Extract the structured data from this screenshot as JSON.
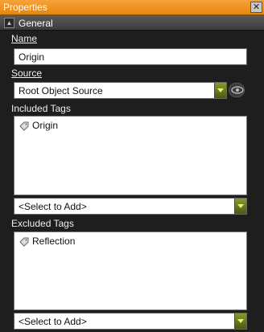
{
  "window": {
    "title": "Properties",
    "close_glyph": "✕"
  },
  "section": {
    "label": "General",
    "collapse_glyph": "▲"
  },
  "name": {
    "label": "Name",
    "value": "Origin"
  },
  "source": {
    "label": "Source",
    "selected": "Root Object Source",
    "toggle_icon": "eye-icon"
  },
  "included": {
    "label": "Included Tags",
    "items": [
      {
        "label": "Origin",
        "icon": "tag-icon"
      }
    ],
    "add_placeholder": "<Select to Add>"
  },
  "excluded": {
    "label": "Excluded Tags",
    "items": [
      {
        "label": "Reflection",
        "icon": "tag-icon"
      }
    ],
    "add_placeholder": "<Select to Add>"
  },
  "colors": {
    "title_bar": "#f09a2a",
    "accent_arrow": "#6a7a1a",
    "background": "#1e1e1e"
  }
}
